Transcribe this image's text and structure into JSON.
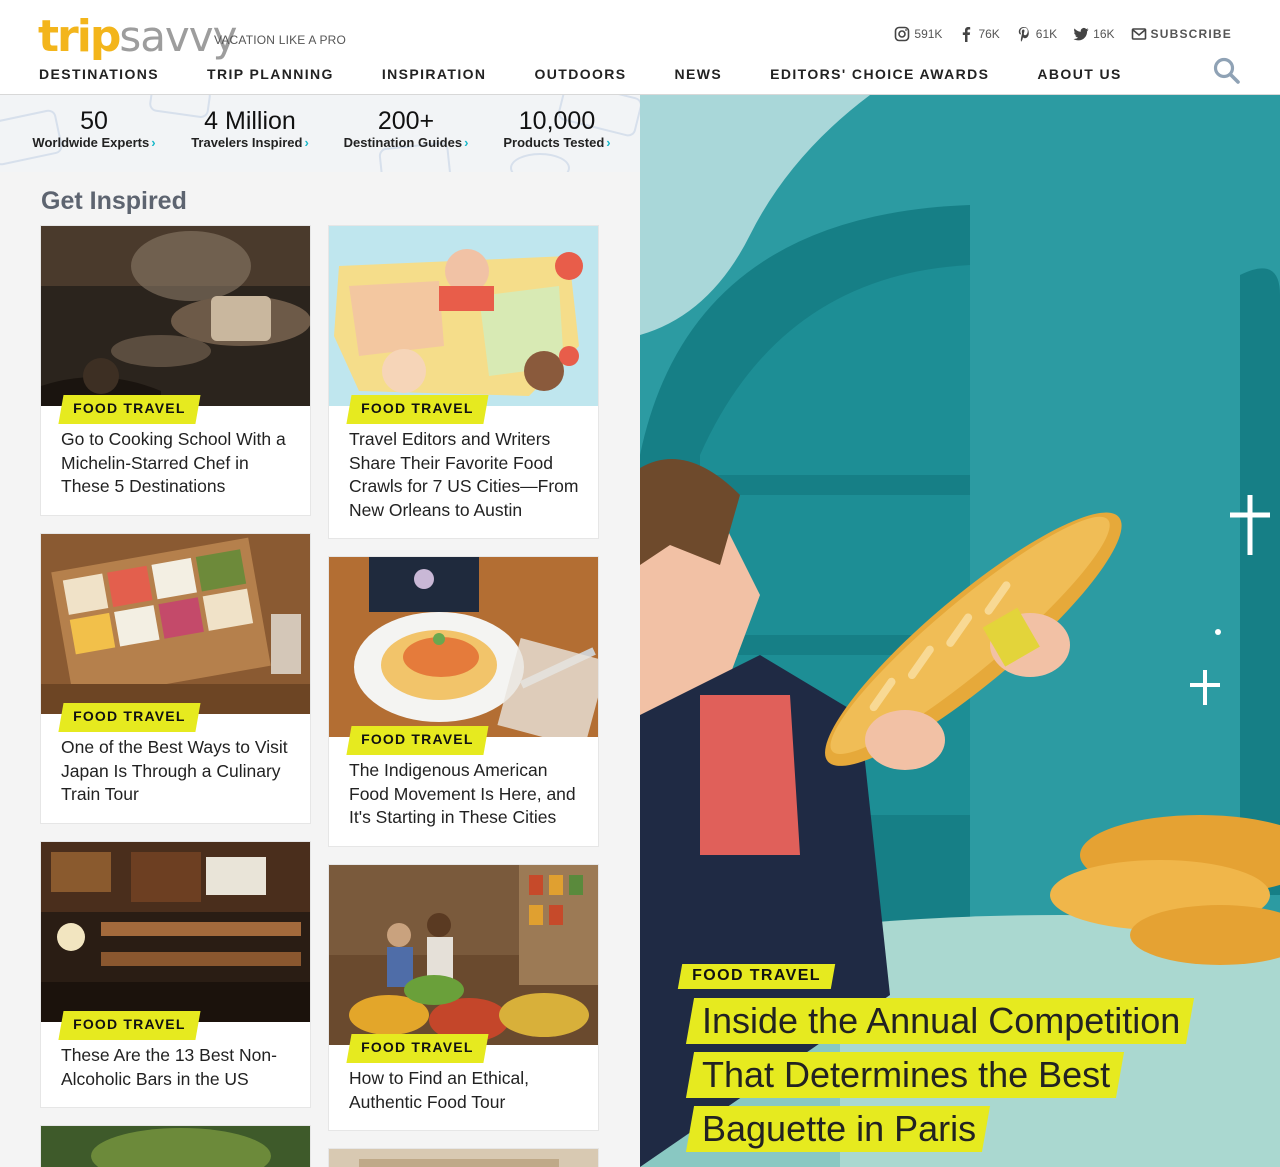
{
  "brand": {
    "logo_part1": "trip",
    "logo_part2": "savvy",
    "tagline": "VACATION LIKE A PRO"
  },
  "social": {
    "instagram": "591K",
    "facebook": "76K",
    "pinterest": "61K",
    "twitter": "16K",
    "subscribe": "SUBSCRIBE"
  },
  "nav": [
    "DESTINATIONS",
    "TRIP PLANNING",
    "INSPIRATION",
    "OUTDOORS",
    "NEWS",
    "EDITORS' CHOICE AWARDS",
    "ABOUT US"
  ],
  "stats": [
    {
      "num": "50",
      "label": "Worldwide Experts"
    },
    {
      "num": "4 Million",
      "label": "Travelers Inspired"
    },
    {
      "num": "200+",
      "label": "Destination Guides"
    },
    {
      "num": "10,000",
      "label": "Products Tested"
    }
  ],
  "section_title": "Get Inspired",
  "cards": [
    {
      "tag": "FOOD TRAVEL",
      "title": "Go to Cooking School With a Michelin-Starred Chef in These 5 Destinations"
    },
    {
      "tag": "FOOD TRAVEL",
      "title": "Travel Editors and Writers Share Their Favorite Food Crawls for 7 US Cities—From New Orleans to Austin"
    },
    {
      "tag": "FOOD TRAVEL",
      "title": "One of the Best Ways to Visit Japan Is Through a Culinary Train Tour"
    },
    {
      "tag": "FOOD TRAVEL",
      "title": "The Indigenous American Food Movement Is Here, and It's Starting in These Cities"
    },
    {
      "tag": "FOOD TRAVEL",
      "title": "These Are the 13 Best Non-Alcoholic Bars in the US"
    },
    {
      "tag": "FOOD TRAVEL",
      "title": "How to Find an Ethical, Authentic Food Tour"
    }
  ],
  "hero": {
    "tag": "FOOD TRAVEL",
    "title_lines": [
      "Inside the Annual Competition",
      "That Determines the Best",
      "Baguette in Paris"
    ]
  },
  "colors": {
    "accent_yellow": "#e6ea1f",
    "teal": "#2c9ba2",
    "logo_gold": "#f3b51b",
    "link_teal": "#18b8c9"
  },
  "icons": [
    "instagram-icon",
    "facebook-icon",
    "pinterest-icon",
    "twitter-icon",
    "mail-icon",
    "search-icon",
    "chevron-right-icon"
  ]
}
